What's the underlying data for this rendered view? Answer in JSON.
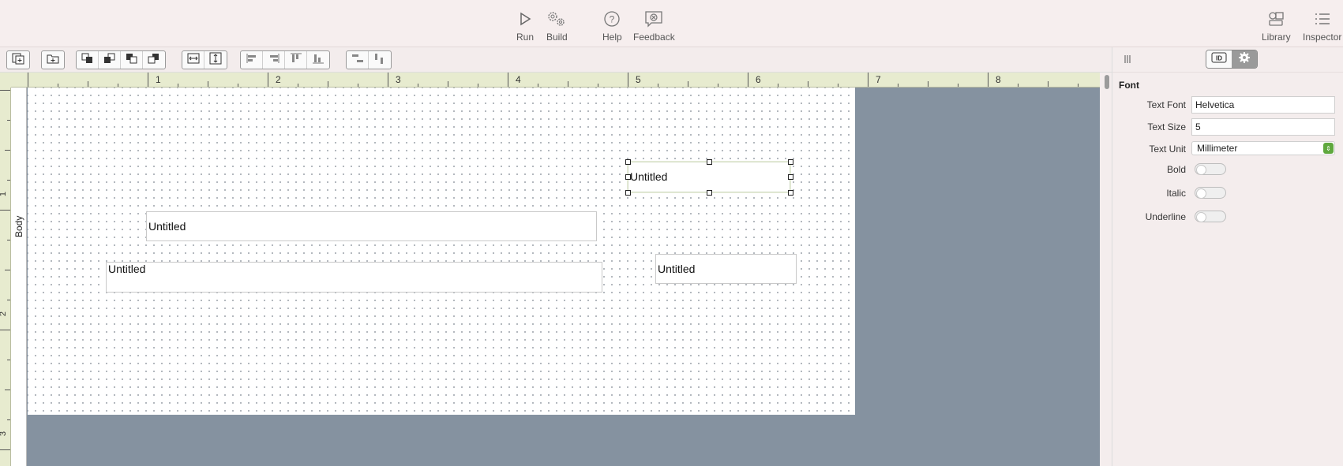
{
  "toolbar": {
    "run_label": "Run",
    "build_label": "Build",
    "help_label": "Help",
    "feedback_label": "Feedback",
    "library_label": "Library",
    "inspector_label": "Inspector"
  },
  "ruler": {
    "horizontal": [
      "1",
      "2",
      "3",
      "4",
      "5",
      "6",
      "7",
      "8"
    ],
    "vertical": [
      "1",
      "2",
      "3"
    ]
  },
  "band": {
    "label": "Body"
  },
  "canvas": {
    "fields": [
      {
        "text": "Untitled",
        "selected": true
      },
      {
        "text": "Untitled",
        "selected": false
      },
      {
        "text": "Untitled",
        "selected": false
      },
      {
        "text": "Untitled",
        "selected": false
      }
    ]
  },
  "inspector": {
    "section_title": "Font",
    "text_font_label": "Text Font",
    "text_font_value": "Helvetica",
    "text_size_label": "Text Size",
    "text_size_value": "5",
    "text_unit_label": "Text Unit",
    "text_unit_value": "Millimeter",
    "bold_label": "Bold",
    "bold_on": false,
    "italic_label": "Italic",
    "italic_on": false,
    "underline_label": "Underline",
    "underline_on": false,
    "tabs": [
      "id-tab",
      "gear-tab"
    ],
    "active_tab": "gear-tab"
  },
  "colors": {
    "canvas_background": "#8592a0",
    "ruler": "#e7ebcf",
    "toggle_accent": "#5fa83e"
  }
}
